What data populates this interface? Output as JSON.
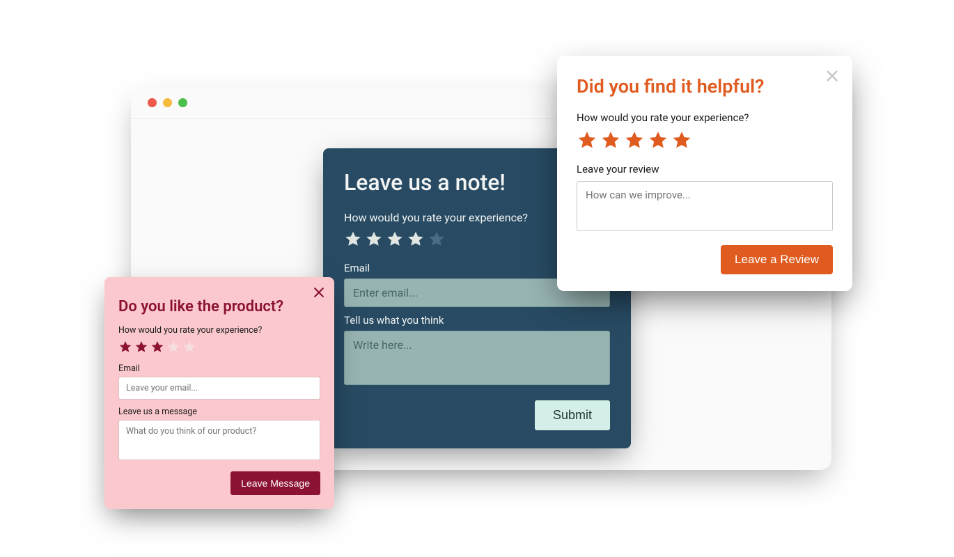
{
  "popup_navy": {
    "title": "Leave us a note!",
    "rate_label": "How would you rate your experience?",
    "rating": 4,
    "max_rating": 5,
    "email_label": "Email",
    "email_placeholder": "Enter email...",
    "message_label": "Tell us what you think",
    "message_placeholder": "Write here...",
    "submit_label": "Submit",
    "colors": {
      "bg": "#284b63",
      "input_bg": "#97b3b2",
      "button_bg": "#d4efe8"
    }
  },
  "popup_pink": {
    "title": "Do you like the product?",
    "rate_label": "How would you rate your experience?",
    "rating": 3,
    "max_rating": 5,
    "email_label": "Email",
    "email_placeholder": "Leave your email...",
    "message_label": "Leave us a message",
    "message_placeholder": "What do you think of our product?",
    "submit_label": "Leave Message",
    "colors": {
      "bg": "#fbc9cd",
      "accent": "#8b1232"
    }
  },
  "popup_orange": {
    "title": "Did you find it helpful?",
    "rate_label": "How would you rate your experience?",
    "rating": 5,
    "max_rating": 5,
    "review_label": "Leave your review",
    "review_placeholder": "How can we improve...",
    "submit_label": "Leave a Review",
    "colors": {
      "bg": "#ffffff",
      "accent": "#e05b1f"
    }
  }
}
